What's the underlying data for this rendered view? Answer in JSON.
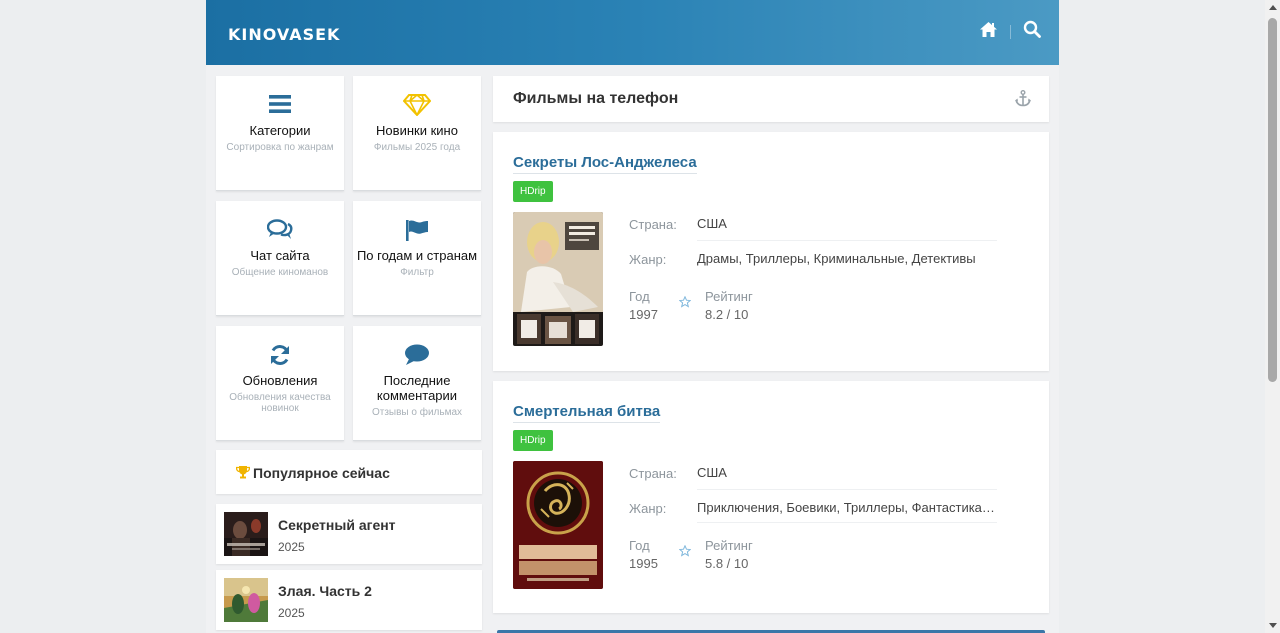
{
  "site": {
    "logo": "KINOVASEK"
  },
  "header": {
    "icons": [
      "home-icon",
      "search-icon"
    ]
  },
  "tiles": [
    {
      "title": "Категории",
      "subtitle": "Сортировка по жанрам",
      "icon": "menu-icon"
    },
    {
      "title": "Новинки кино",
      "subtitle": "Фильмы 2025 года",
      "icon": "diamond-icon"
    },
    {
      "title": "Чат сайта",
      "subtitle": "Общение киноманов",
      "icon": "chat-icon"
    },
    {
      "title": "По годам и странам",
      "subtitle": "Фильтр",
      "icon": "flag-icon"
    },
    {
      "title": "Обновления",
      "subtitle": "Обновления качества новинок",
      "icon": "refresh-icon"
    },
    {
      "title": "Последние комментарии",
      "subtitle": "Отзывы о фильмах",
      "icon": "comment-icon"
    }
  ],
  "popular": {
    "title": "Популярное сейчас",
    "items": [
      {
        "title": "Секретный агент",
        "year": "2025"
      },
      {
        "title": "Злая. Часть 2",
        "year": "2025"
      }
    ]
  },
  "main": {
    "title": "Фильмы на телефон",
    "movies": [
      {
        "title": "Секреты Лос-Анджелеса",
        "quality": "HDrip",
        "country_label": "Страна:",
        "country": "США",
        "genre_label": "Жанр:",
        "genre": "Драмы, Триллеры, Криминальные, Детективы",
        "year_label": "Год",
        "year": "1997",
        "rating_label": "Рейтинг",
        "rating": "8.2 / 10"
      },
      {
        "title": "Смертельная битва",
        "quality": "HDrip",
        "country_label": "Страна:",
        "country": "США",
        "genre_label": "Жанр:",
        "genre": "Приключения, Боевики, Триллеры, Фантастика…",
        "year_label": "Год",
        "year": "1995",
        "rating_label": "Рейтинг",
        "rating": "5.8 / 10"
      }
    ]
  },
  "colors": {
    "accent": "#2b6d99",
    "badge": "#3fc23f",
    "header_start": "#1b6fa3",
    "header_end": "#4b9ac4",
    "icon": "#2b6d99",
    "diamond": "#f2c200",
    "trophy": "#f0b400"
  }
}
